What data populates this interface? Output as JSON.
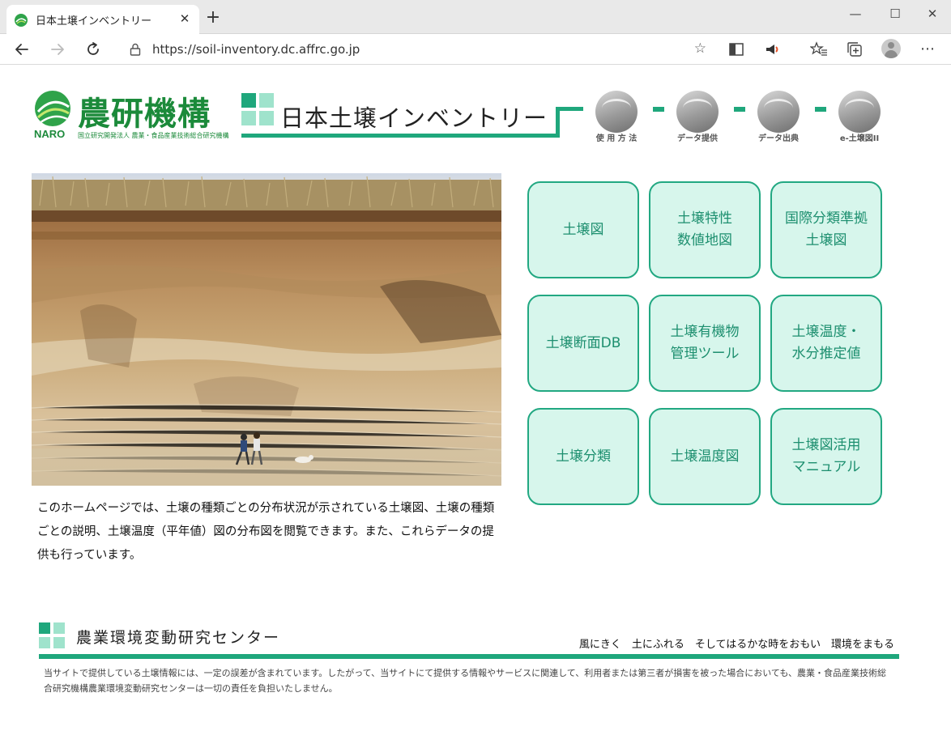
{
  "browser": {
    "tab_title": "日本土壌インベントリー",
    "tab_close": "✕",
    "new_tab": "+",
    "url": "https://soil-inventory.dc.affrc.go.jp",
    "window_min": "—",
    "window_max": "☐",
    "window_close": "✕",
    "more": "⋯"
  },
  "header": {
    "org_name": "農研機構",
    "org_acronym": "NARO",
    "org_fullname": "国立研究開発法人 農業・食品産業技術総合研究機構",
    "site_title": "日本土壌インベントリー",
    "nav_links": [
      {
        "label": "使 用 方 法"
      },
      {
        "label": "データ提供"
      },
      {
        "label": "データ出典"
      },
      {
        "label": "e-土壌図II"
      }
    ]
  },
  "main": {
    "intro_text": "このホームページでは、土壌の種類ごとの分布状況が示されている土壌図、土壌の種類ごとの説明、土壌温度（平年値）図の分布図を閲覧できます。また、これらデータの提供も行っています。",
    "buttons": [
      {
        "label": "土壌図"
      },
      {
        "label": "土壌特性\n数値地図"
      },
      {
        "label": "国際分類準拠\n土壌図"
      },
      {
        "label": "土壌断面DB"
      },
      {
        "label": "土壌有機物\n管理ツール"
      },
      {
        "label": "土壌温度・\n水分推定値"
      },
      {
        "label": "土壌分類"
      },
      {
        "label": "土壌温度図"
      },
      {
        "label": "土壌図活用\nマニュアル"
      }
    ]
  },
  "footer": {
    "center_name": "農業環境変動研究センター",
    "tagline": "風にきく　土にふれる　そしてはるかな時をおもい　環境をまもる",
    "disclaimer": "当サイトで提供している土壌情報には、一定の誤差が含まれています。したがって、当サイトにて提供する情報やサービスに関連して、利用者または第三者が損害を被った場合においても、農業・食品産業技術総合研究機構農業環境変動研究センターは一切の責任を負担いたしません。"
  },
  "colors": {
    "accent_green": "#1fa77c",
    "button_fill": "#d7f6ec",
    "button_text": "#1d8f6f",
    "naro_green": "#1b8a3a"
  }
}
